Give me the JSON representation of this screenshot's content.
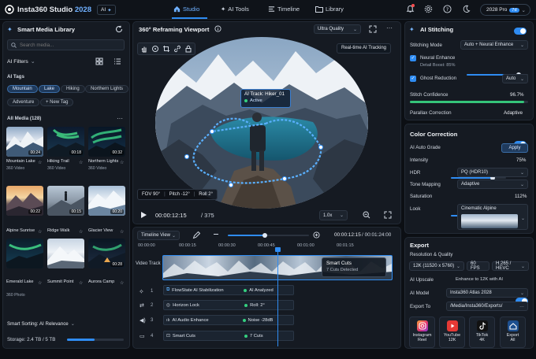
{
  "app": {
    "name": "Insta360 Studio",
    "version": "2028",
    "ai_badge": "AI",
    "plan": "2028 Pro",
    "plan_badge": "7d"
  },
  "nav": {
    "tabs": [
      {
        "label": "Studio"
      },
      {
        "label": "AI Tools"
      },
      {
        "label": "Timeline"
      },
      {
        "label": "Library"
      }
    ]
  },
  "library": {
    "title": "Smart Media Library",
    "search_placeholder": "Search media...",
    "filters_label": "AI Filters",
    "tags_label": "AI Tags",
    "tags": [
      "Mountain",
      "Lake",
      "Hiking",
      "Northern Lights",
      "Adventure"
    ],
    "new_tag": "+ New Tag",
    "all_media": "All Media (128)",
    "items": [
      {
        "name": "Mountain Lake",
        "type": "360 Video",
        "dur": "00:24"
      },
      {
        "name": "Hiking Trail",
        "type": "360 Video",
        "dur": "00:18"
      },
      {
        "name": "Northern Lights",
        "type": "360 Video",
        "dur": "00:32"
      },
      {
        "name": "Alpine Sunrise",
        "type": "",
        "dur": "00:22"
      },
      {
        "name": "Ridge Walk",
        "type": "",
        "dur": "00:15"
      },
      {
        "name": "Glacier View",
        "type": "",
        "dur": "00:20"
      },
      {
        "name": "Emerald Lake",
        "type": "360 Photo",
        "dur": ""
      },
      {
        "name": "Summit Point",
        "type": "",
        "dur": ""
      },
      {
        "name": "Aurora Camp",
        "type": "",
        "dur": "00:28"
      }
    ],
    "sorting": "Smart Sorting: AI Relevance",
    "storage": "Storage: 2.4 TB / 5 TB",
    "storage_fraction": 0.48
  },
  "viewport": {
    "title": "360° Reframing Viewport",
    "quality": "Ultra Quality",
    "tracking": "Real-time AI Tracking",
    "track_label": "AI Track: Hiker_01",
    "track_status": "Active",
    "fov": "FOV 90°",
    "pitch": "Pitch -12°",
    "roll": "Roll 2°",
    "time": "00:00:12:15",
    "total": "/ 375",
    "speed": "1.0x"
  },
  "timeline": {
    "view": "Timeline View",
    "time_current": "00:00:12:15",
    "time_total": "00:01:24:00",
    "ticks": [
      "00:00:00",
      "00:00:15",
      "00:00:30",
      "00:00:45",
      "00:01:00",
      "00:01:15"
    ],
    "video_track": "Video Track",
    "smart_cuts": "Smart Cuts",
    "cuts_detected": "7 Cuts Detected",
    "tracks": [
      {
        "num": "1",
        "name": "FlowState AI Stabilization",
        "status": "AI Analyzed"
      },
      {
        "num": "2",
        "name": "Horizon Lock",
        "status": "Roll: 2°"
      },
      {
        "num": "3",
        "name": "AI Audio Enhance",
        "status": "Noise -28dB"
      },
      {
        "num": "4",
        "name": "Smart Cuts",
        "status": "7 Cuts"
      }
    ]
  },
  "stitching": {
    "title": "AI Stitching",
    "mode_label": "Stitching Mode",
    "mode": "Auto + Neural Enhance",
    "neural": "Neural Enhance",
    "detail_boost": "Detail Boost: 85%",
    "detail_value": 0.85,
    "ghost": "Ghost Reduction",
    "ghost_mode": "Auto",
    "confidence_label": "Stitch Confidence",
    "confidence": "96.7%",
    "confidence_value": 0.967,
    "parallax_label": "Parallax Correction",
    "parallax": "Adaptive"
  },
  "color": {
    "title": "Color Correction",
    "grade_label": "AI Auto Grade",
    "apply": "Apply",
    "intensity_label": "Intensity",
    "intensity": "75%",
    "intensity_value": 0.75,
    "hdr_label": "HDR",
    "hdr": "PQ (HDR10)",
    "tone_label": "Tone Mapping",
    "tone": "Adaptive",
    "sat_label": "Saturation",
    "sat": "112%",
    "sat_value": 0.56,
    "look_label": "Look",
    "look": "Cinematic Alpine"
  },
  "export": {
    "title": "Export",
    "res_label": "Resolution & Quality",
    "res": "12K (11520 x 5760)",
    "fps": "60 FPS",
    "codec": "H.265 / HEVC",
    "upscale_label": "AI Upscale",
    "upscale": "Enhance to 12K with AI",
    "model_label": "AI Model",
    "model": "Insta360 Atlas 2028",
    "to_label": "Export To",
    "to": "/Media/Insta360/Exports/",
    "targets": [
      {
        "l1": "Instagram",
        "l2": "Reel"
      },
      {
        "l1": "YouTube",
        "l2": "12K"
      },
      {
        "l1": "TikTok",
        "l2": "4K"
      },
      {
        "l1": "Export",
        "l2": "All"
      }
    ]
  },
  "colors": {
    "accent": "#2f8cf2",
    "bg": "#0c0f14",
    "panel": "#151a22"
  }
}
